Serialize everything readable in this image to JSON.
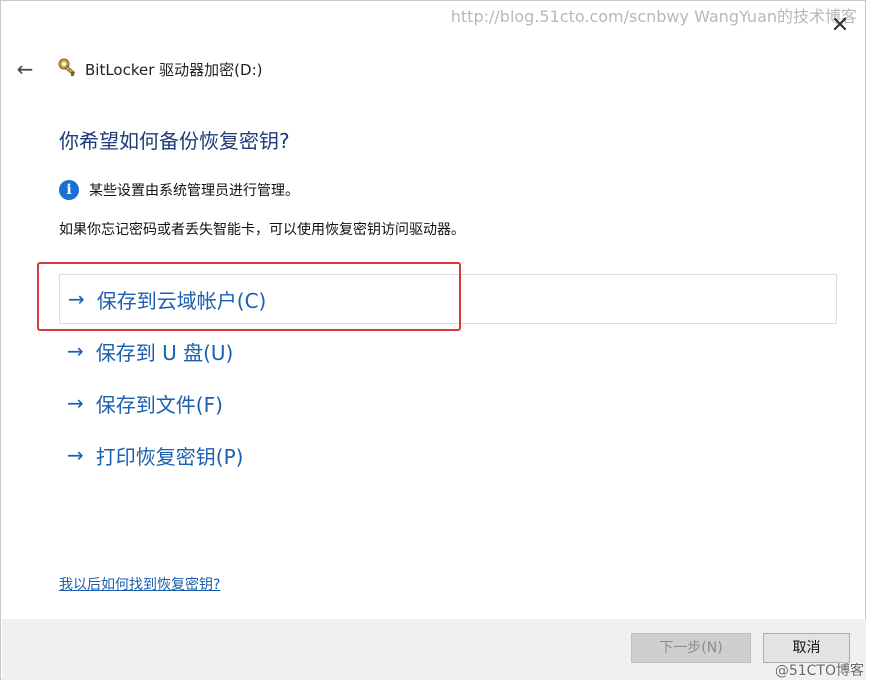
{
  "watermark_top": "http://blog.51cto.com/scnbwy WangYuan的技术博客",
  "watermark_bottom": "@51CTO博客",
  "titlebar": {
    "app_title": "BitLocker 驱动器加密(D:)",
    "back_icon": "back-arrow-icon",
    "close_label": "✕"
  },
  "main": {
    "heading": "你希望如何备份恢复密钥?",
    "info_text": "某些设置由系统管理员进行管理。",
    "description": "如果你忘记密码或者丢失智能卡，可以使用恢复密钥访问驱动器。",
    "options": [
      {
        "label": "保存到云域帐户(C)"
      },
      {
        "label": "保存到 U 盘(U)"
      },
      {
        "label": "保存到文件(F)"
      },
      {
        "label": "打印恢复密钥(P)"
      }
    ],
    "help_link": "我以后如何找到恢复密钥?"
  },
  "footer": {
    "next_label": "下一步(N)",
    "cancel_label": "取消"
  },
  "colors": {
    "accent": "#1a5fb0",
    "heading": "#1e3c78",
    "highlight": "#d93838",
    "info": "#1a6fd4"
  }
}
